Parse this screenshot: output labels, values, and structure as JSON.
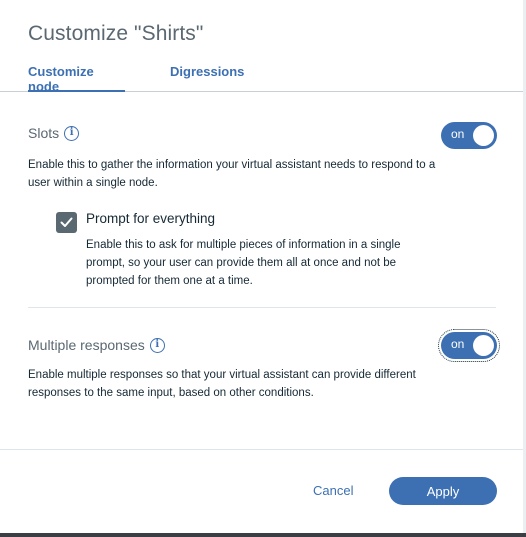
{
  "dialog": {
    "title": "Customize \"Shirts\""
  },
  "tabs": [
    {
      "label": "Customize node",
      "active": true
    },
    {
      "label": "Digressions",
      "active": false
    }
  ],
  "slots": {
    "label": "Slots",
    "info_icon": "info-icon",
    "toggle_label": "on",
    "toggle_state": true,
    "description": "Enable this to gather the information your virtual assistant needs to respond to a user within a single node."
  },
  "prompt_for_everything": {
    "label": "Prompt for everything",
    "checked": true,
    "description": "Enable this to ask for multiple pieces of information in a single prompt, so your user can provide them all at once and not be prompted for them one at a time."
  },
  "multiple_responses": {
    "label": "Multiple responses",
    "info_icon": "info-icon",
    "toggle_label": "on",
    "toggle_state": true,
    "description": "Enable multiple responses so that your virtual assistant can provide different responses to the same input, based on other conditions."
  },
  "footer": {
    "cancel_label": "Cancel",
    "apply_label": "Apply"
  },
  "colors": {
    "accent": "#3d70b2",
    "text_primary": "#152935",
    "text_secondary": "#5a6872"
  }
}
